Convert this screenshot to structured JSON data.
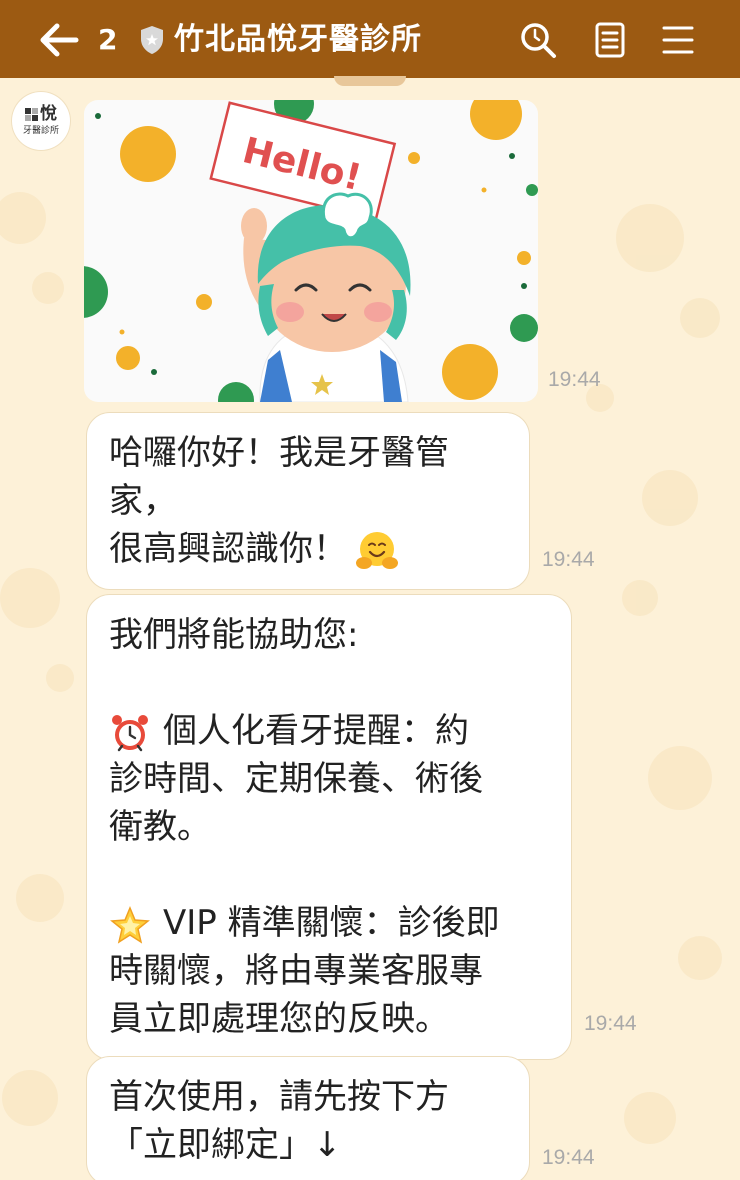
{
  "header": {
    "unread_count": "2",
    "title": "竹北品悅牙醫診所",
    "icons": [
      "back-arrow-icon",
      "shield-badge-icon",
      "search-icon",
      "notes-icon",
      "menu-icon"
    ]
  },
  "avatar": {
    "logo_text": "悅",
    "logo_subtext": "牙醫診所"
  },
  "messages": [
    {
      "type": "sticker",
      "sticker_text": "Hello!",
      "time": "19:44"
    },
    {
      "type": "text",
      "lines": [
        "哈囉你好！我是牙醫管",
        "家，",
        "很高興認識你！"
      ],
      "trailing_emoji": "hugging-face-icon",
      "time": "19:44"
    },
    {
      "type": "text",
      "intro": "我們將能協助您:",
      "item1_icon": "alarm-clock-icon",
      "item1_lines": [
        "個人化看牙提醒：約",
        "診時間、定期保養、術後",
        "衛教。"
      ],
      "item2_icon": "glowing-star-icon",
      "item2_lines": [
        "VIP 精準關懷：診後即",
        "時關懷，將由專業客服專",
        "員立即處理您的反映。"
      ],
      "time": "19:44"
    },
    {
      "type": "text",
      "lines": [
        "首次使用，請先按下方",
        "「立即綁定」↓"
      ],
      "time": "19:44"
    }
  ],
  "colors": {
    "header_bg": "#9c5a12",
    "chat_bg": "#fdf1d8",
    "bubble_bg": "#ffffff",
    "timestamp": "#a9a9a9"
  }
}
